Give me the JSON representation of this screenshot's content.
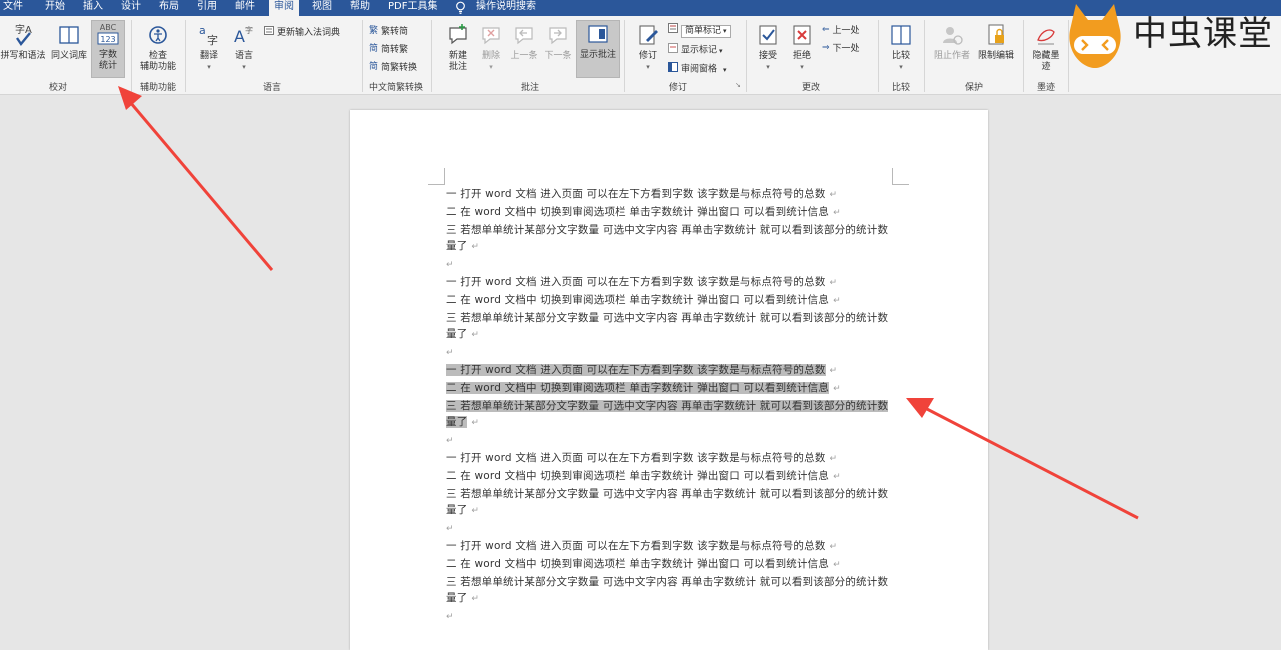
{
  "menubar": {
    "items": [
      "文件",
      "开始",
      "插入",
      "设计",
      "布局",
      "引用",
      "邮件",
      "审阅",
      "视图",
      "帮助",
      "PDF工具集"
    ],
    "active": "审阅",
    "tell_me": "操作说明搜索"
  },
  "ribbon": {
    "groups": {
      "proofing": "校对",
      "accessibility": "辅助功能",
      "language": "语言",
      "chinese_conversion": "中文简繁转换",
      "comments": "批注",
      "tracking": "修订",
      "changes": "更改",
      "compare": "比较",
      "protect": "保护",
      "ink": "墨迹"
    },
    "buttons": {
      "spelling": "拼写和语法",
      "thesaurus": "同义词库",
      "word_count_icon_text": [
        "ABC",
        "123"
      ],
      "word_count_l1": "字数",
      "word_count_l2": "统计",
      "check_access_l1": "检查",
      "check_access_l2": "辅助功能",
      "translate": "翻译",
      "language": "语言",
      "update_ime": "更新输入法词典",
      "to_simplified": "繁转简",
      "to_traditional": "简转繁",
      "convert": "简繁转换",
      "new_comment_l1": "新建",
      "new_comment_l2": "批注",
      "delete": "删除",
      "previous": "上一条",
      "next": "下一条",
      "show_comments": "显示批注",
      "track_changes": "修订",
      "markup_combo": "简单标记",
      "show_markup": "显示标记",
      "reviewing_pane": "审阅窗格",
      "accept": "接受",
      "reject": "拒绝",
      "prev_change": "上一处",
      "next_change": "下一处",
      "compare": "比较",
      "block_authors": "阻止作者",
      "restrict_editing": "限制编辑",
      "hide_ink_l1": "隐藏墨",
      "hide_ink_l2": "迹"
    }
  },
  "document": {
    "paragraphs": [
      {
        "lines": [
          "一  打开 word 文档   进入页面   可以在左下方看到字数   该字数是与标点符号的总数",
          "二  在 word 文档中   切换到审阅选项栏   单击字数统计   弹出窗口   可以看到统计信息",
          "三  若想单单统计某部分文字数量   可选中文字内容   再单击字数统计   就可以看到该部分的统计数量了"
        ],
        "selected": false
      },
      {
        "lines": [
          "一  打开 word 文档   进入页面   可以在左下方看到字数   该字数是与标点符号的总数",
          "二  在 word 文档中   切换到审阅选项栏   单击字数统计   弹出窗口   可以看到统计信息",
          "三  若想单单统计某部分文字数量   可选中文字内容   再单击字数统计   就可以看到该部分的统计数量了"
        ],
        "selected": false
      },
      {
        "lines": [
          "一  打开 word 文档   进入页面   可以在左下方看到字数   该字数是与标点符号的总数",
          "二  在 word 文档中   切换到审阅选项栏   单击字数统计   弹出窗口   可以看到统计信息",
          "三  若想单单统计某部分文字数量   可选中文字内容   再单击字数统计   就可以看到该部分的统计数量了"
        ],
        "selected": true
      },
      {
        "lines": [
          "一  打开 word 文档   进入页面   可以在左下方看到字数   该字数是与标点符号的总数",
          "二  在 word 文档中   切换到审阅选项栏   单击字数统计   弹出窗口   可以看到统计信息",
          "三  若想单单统计某部分文字数量   可选中文字内容   再单击字数统计   就可以看到该部分的统计数量了"
        ],
        "selected": false
      },
      {
        "lines": [
          "一  打开 word 文档   进入页面   可以在左下方看到字数   该字数是与标点符号的总数",
          "二  在 word 文档中   切换到审阅选项栏   单击字数统计   弹出窗口   可以看到统计信息",
          "三  若想单单统计某部分文字数量   可选中文字内容   再单击字数统计   就可以看到该部分的统计数量了"
        ],
        "selected": false
      }
    ],
    "para_mark": "↵"
  },
  "logo": {
    "text": "中虫课堂",
    "icon": "fox-mascot-icon"
  },
  "colors": {
    "menubar": "#2b579a",
    "ribbon": "#f3f3f3",
    "arrow": "#f0433a",
    "selection": "#bcbcbc"
  }
}
